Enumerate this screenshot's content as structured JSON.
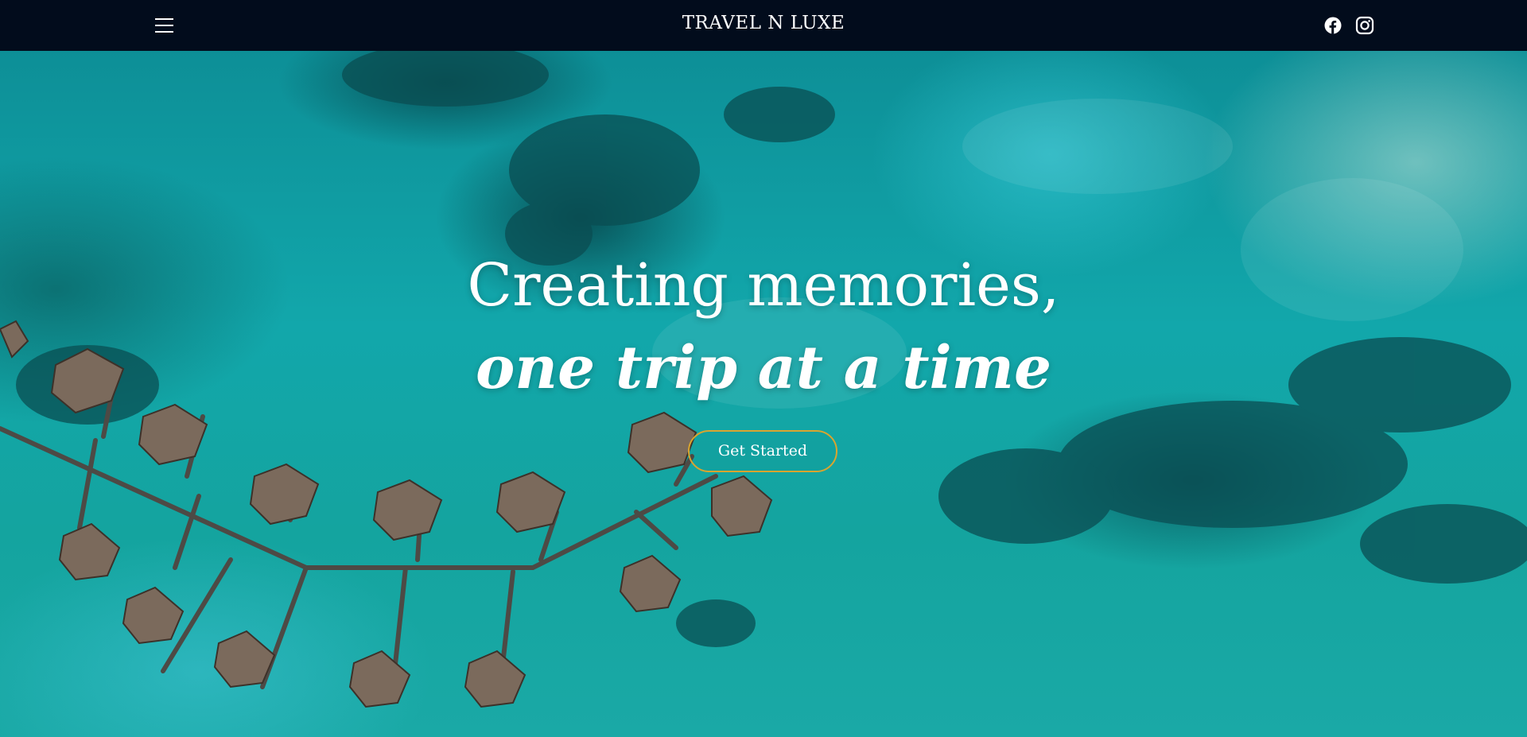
{
  "header": {
    "brand": "TRAVEL N LUXE",
    "menu_icon": "hamburger-menu-icon",
    "social": [
      {
        "name": "facebook",
        "icon": "facebook-icon"
      },
      {
        "name": "instagram",
        "icon": "instagram-icon"
      }
    ]
  },
  "hero": {
    "title": "Creating memories,",
    "subtitle": "one trip at a time",
    "cta_label": "Get Started",
    "background_image": "aerial view of overwater bungalows"
  },
  "colors": {
    "nav_background": "#020c1c",
    "text": "#ffffff",
    "cta_border": "#d9a52f",
    "ocean": "#12a7ab"
  }
}
